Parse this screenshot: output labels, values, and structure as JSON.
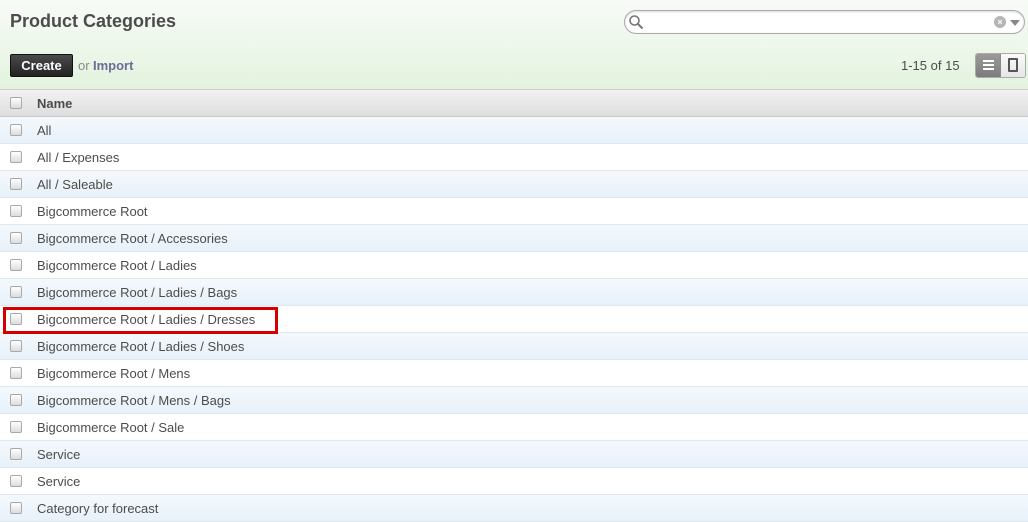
{
  "header": {
    "title": "Product Categories",
    "search": {
      "value": "",
      "placeholder": ""
    }
  },
  "toolbar": {
    "create_label": "Create",
    "or_label": "or",
    "import_label": "Import",
    "pager": "1-15 of 15"
  },
  "table": {
    "column_name": "Name",
    "rows": [
      "All",
      "All / Expenses",
      "All / Saleable",
      "Bigcommerce Root",
      "Bigcommerce Root / Accessories",
      "Bigcommerce Root / Ladies",
      "Bigcommerce Root / Ladies / Bags",
      "Bigcommerce Root / Ladies / Dresses",
      "Bigcommerce Root / Ladies / Shoes",
      "Bigcommerce Root / Mens",
      "Bigcommerce Root / Mens / Bags",
      "Bigcommerce Root / Sale",
      "Service",
      "Service",
      "Category for forecast"
    ]
  },
  "icons": {
    "search": "search-icon",
    "clear": "clear-icon",
    "dropdown": "chevron-down-icon",
    "list_view": "list-view-icon",
    "form_view": "form-view-icon"
  },
  "colors": {
    "highlight": "#d40000",
    "header_gradient_end": "#e3f3de",
    "row_stripe": "#e7f1f9",
    "import_link": "#6c6c97"
  }
}
